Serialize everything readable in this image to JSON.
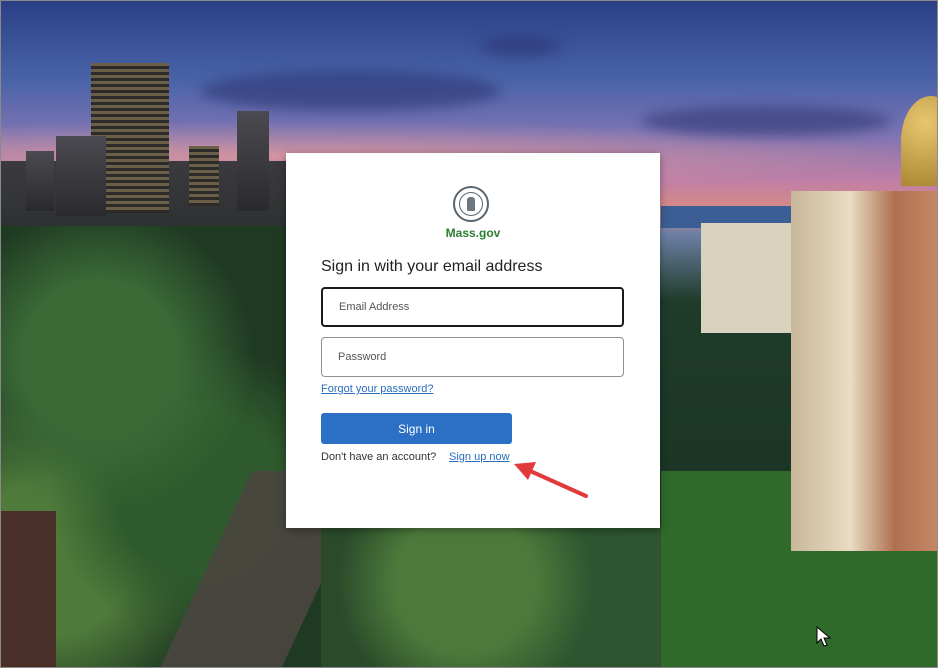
{
  "brand": {
    "name": "Mass.gov",
    "logo_icon": "state-seal-icon",
    "brand_color": "#2f7d32"
  },
  "form": {
    "heading": "Sign in with your email address",
    "email_placeholder": "Email Address",
    "password_placeholder": "Password",
    "forgot_password": "Forgot your password?",
    "sign_in_button": "Sign in",
    "no_account_text": "Don't have an account?",
    "sign_up_link": "Sign up now"
  },
  "colors": {
    "button": "#2b70c4",
    "link": "#2a6ebb",
    "annotation_arrow": "#e03a3a"
  },
  "overlay": {
    "annotation": "red-arrow-icon",
    "cursor": "mouse-pointer-icon"
  }
}
